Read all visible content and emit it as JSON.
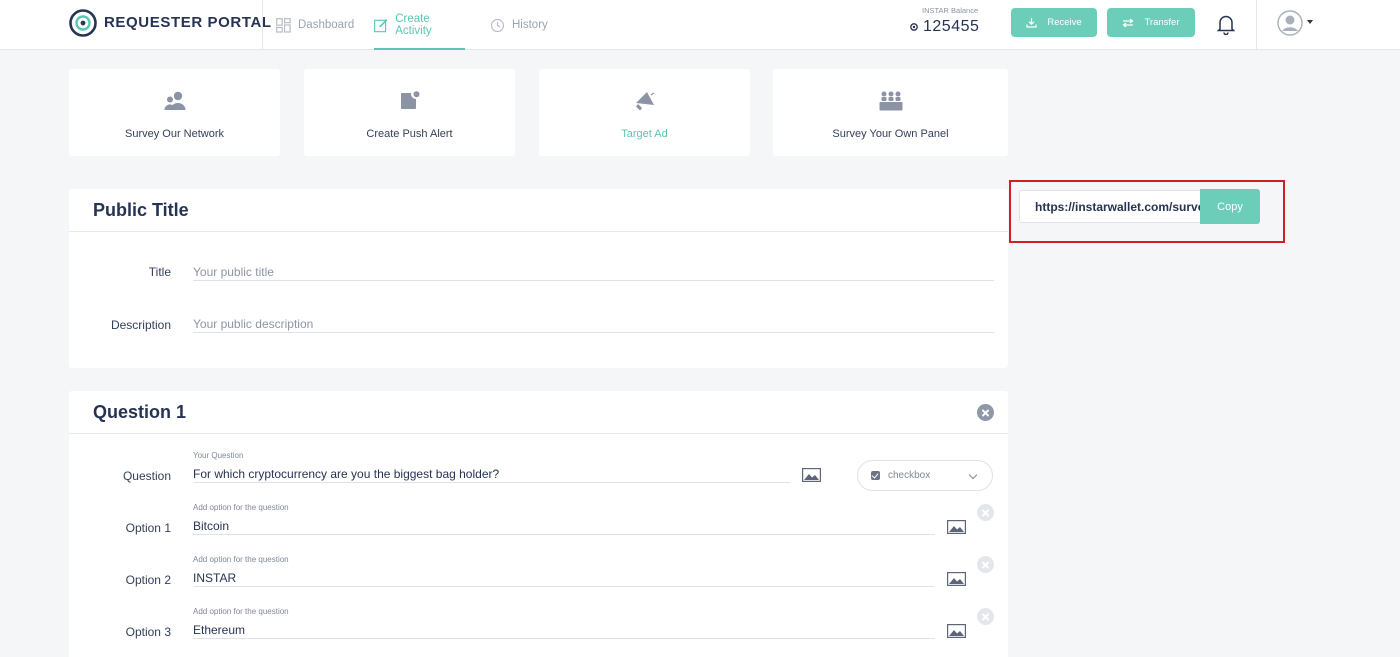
{
  "header": {
    "brand": "REQUESTER PORTAL",
    "nav": [
      {
        "label": "Dashboard",
        "icon": "dashboard-icon"
      },
      {
        "label": "Create Activity",
        "icon": "edit-icon",
        "active": true
      },
      {
        "label": "History",
        "icon": "history-icon"
      }
    ],
    "balance_label": "INSTAR Balance",
    "balance_value": "125455",
    "receive_label": "Receive",
    "transfer_label": "Transfer"
  },
  "activity_cards": [
    {
      "label": "Survey Our Network",
      "icon": "users-icon"
    },
    {
      "label": "Create Push Alert",
      "icon": "push-alert-icon"
    },
    {
      "label": "Target Ad",
      "icon": "megaphone-icon",
      "selected": true
    },
    {
      "label": "Survey Your Own Panel",
      "icon": "panel-group-icon"
    }
  ],
  "public_title": {
    "heading": "Public Title",
    "title_label": "Title",
    "title_placeholder": "Your public title",
    "description_label": "Description",
    "description_placeholder": "Your public description"
  },
  "question": {
    "heading": "Question 1",
    "question_label": "Question",
    "question_hint": "Your Question",
    "question_value": "For which cryptocurrency are you the biggest bag holder?",
    "type_value": "checkbox",
    "option_hint": "Add option for the question",
    "options": [
      {
        "label": "Option 1",
        "value": "Bitcoin"
      },
      {
        "label": "Option 2",
        "value": "INSTAR"
      },
      {
        "label": "Option 3",
        "value": "Ethereum"
      }
    ]
  },
  "share": {
    "url": "https://instarwallet.com/survey",
    "copy_label": "Copy"
  },
  "colors": {
    "accent": "#6ccdb9",
    "highlight_border": "#cf1e25",
    "brand_text": "#263352"
  }
}
